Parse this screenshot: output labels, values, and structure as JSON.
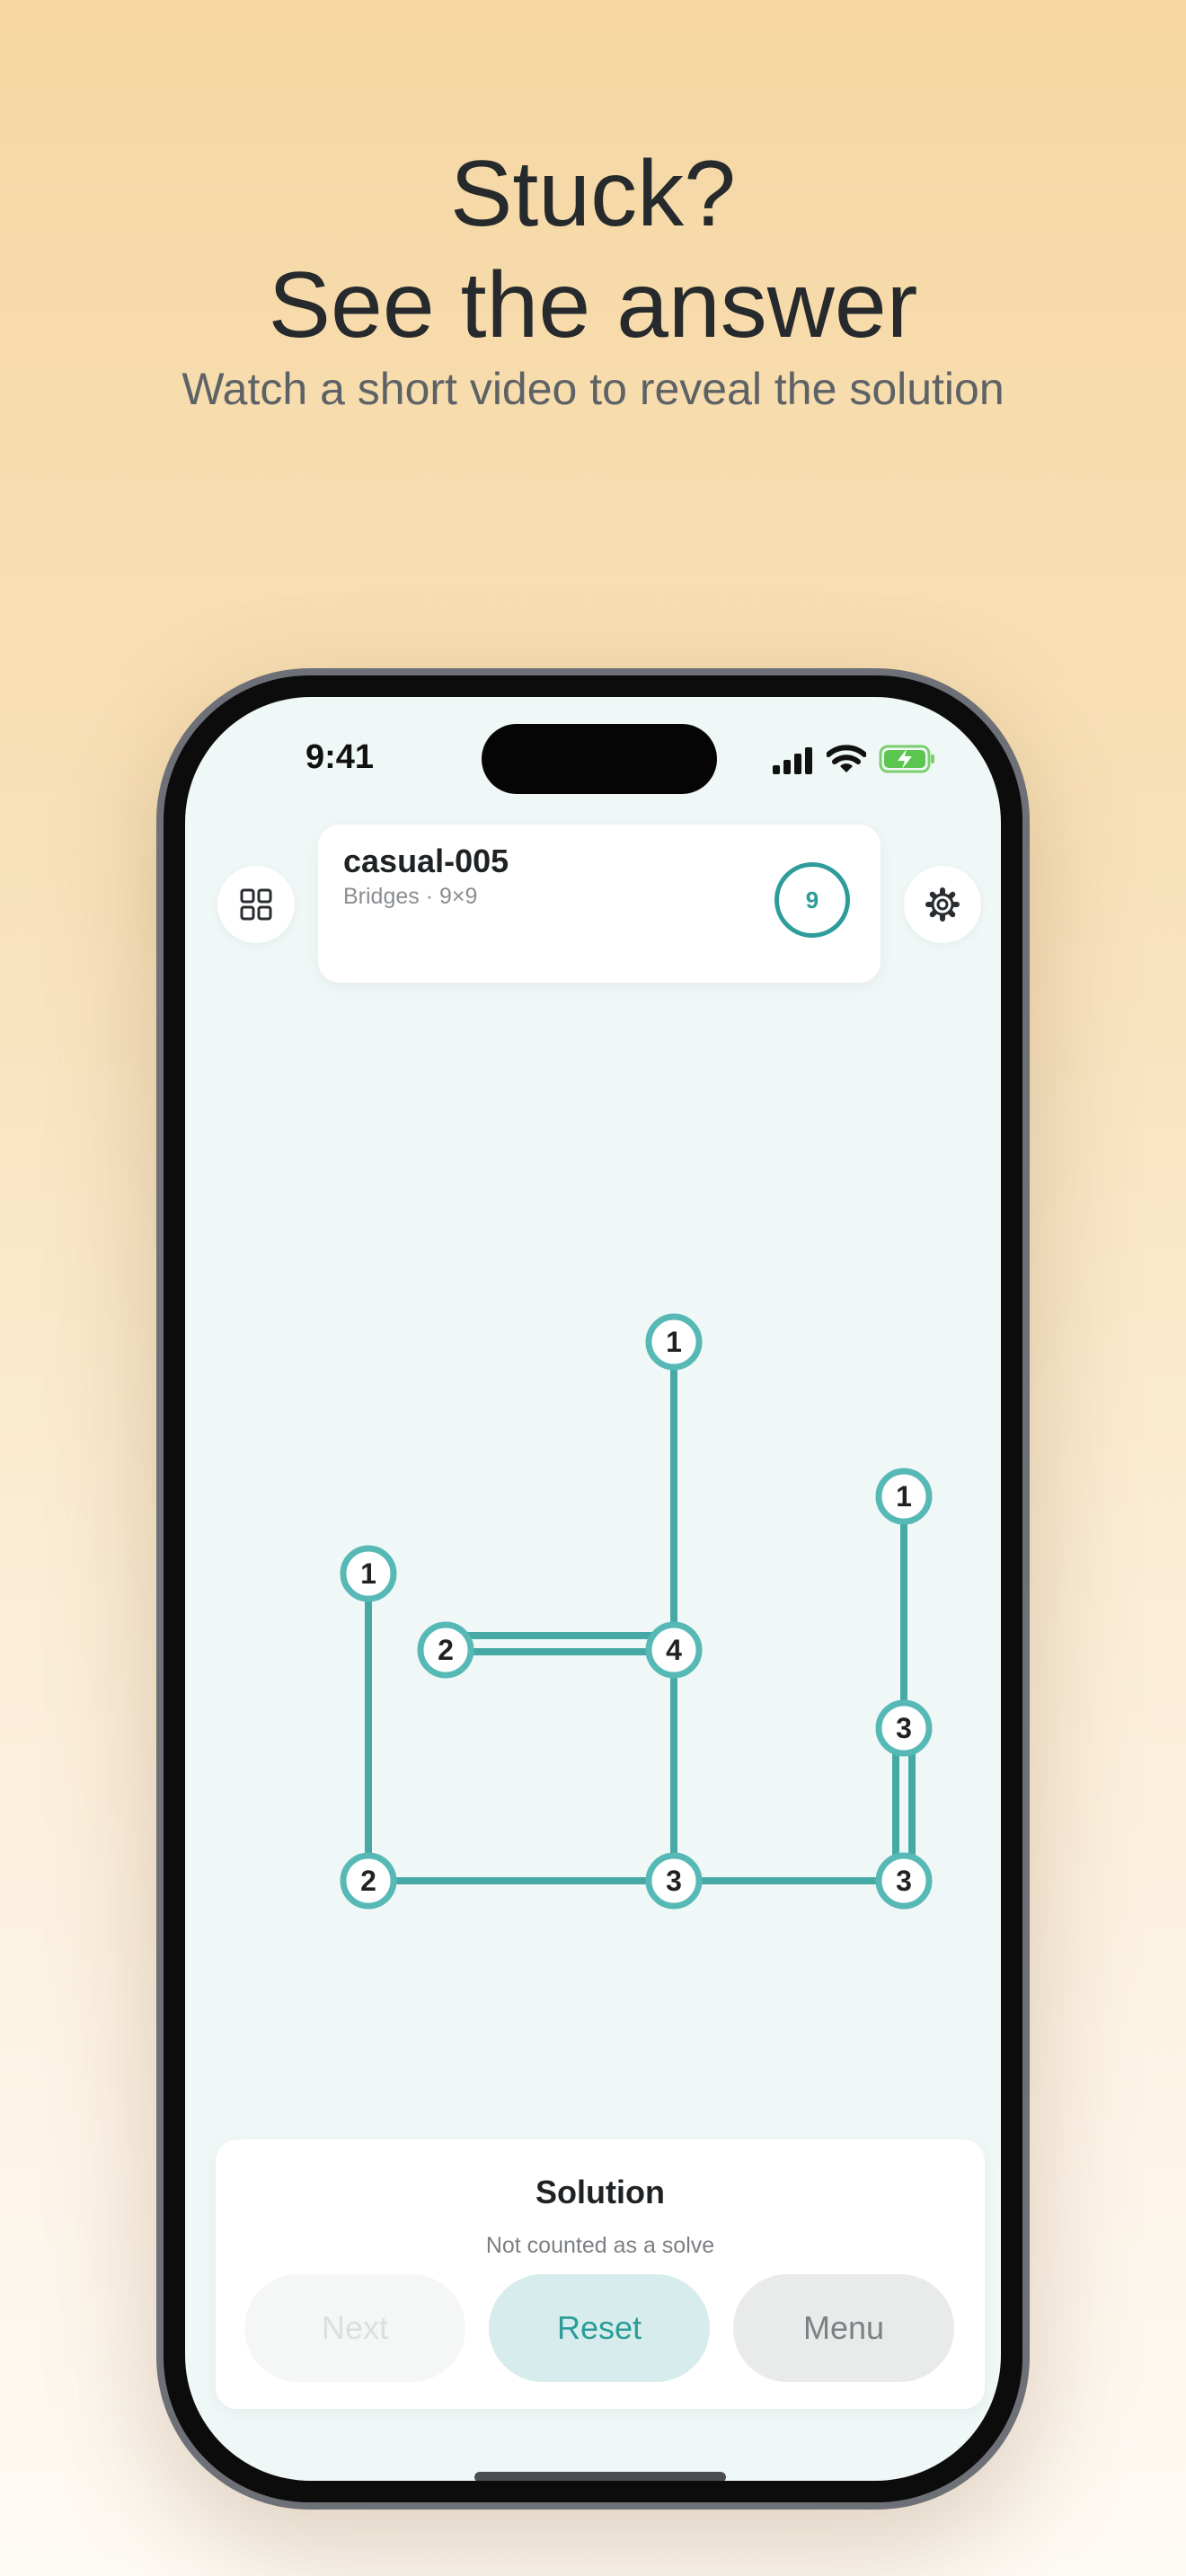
{
  "headline": {
    "line1": "Stuck?",
    "line2": "See the answer"
  },
  "subtitle": "Watch a short video to reveal the solution",
  "status_bar": {
    "time": "9:41"
  },
  "header": {
    "menu_icon": "grid-icon",
    "settings_icon": "gear-icon",
    "puzzle_id": "casual-005",
    "puzzle_meta": "Bridges · 9×9",
    "count": "9"
  },
  "board": {
    "islands": [
      {
        "label": "1"
      },
      {
        "label": "1"
      },
      {
        "label": "1"
      },
      {
        "label": "2"
      },
      {
        "label": "4"
      },
      {
        "label": "3"
      },
      {
        "label": "2"
      },
      {
        "label": "3"
      },
      {
        "label": "3"
      }
    ]
  },
  "panel": {
    "title": "Solution",
    "subtitle": "Not counted as a solve",
    "buttons": {
      "next": "Next",
      "reset": "Reset",
      "menu": "Menu"
    }
  },
  "colors": {
    "accent": "#2e9d9a",
    "island_ring": "#57b9b5",
    "bridge": "#46a9a6"
  }
}
